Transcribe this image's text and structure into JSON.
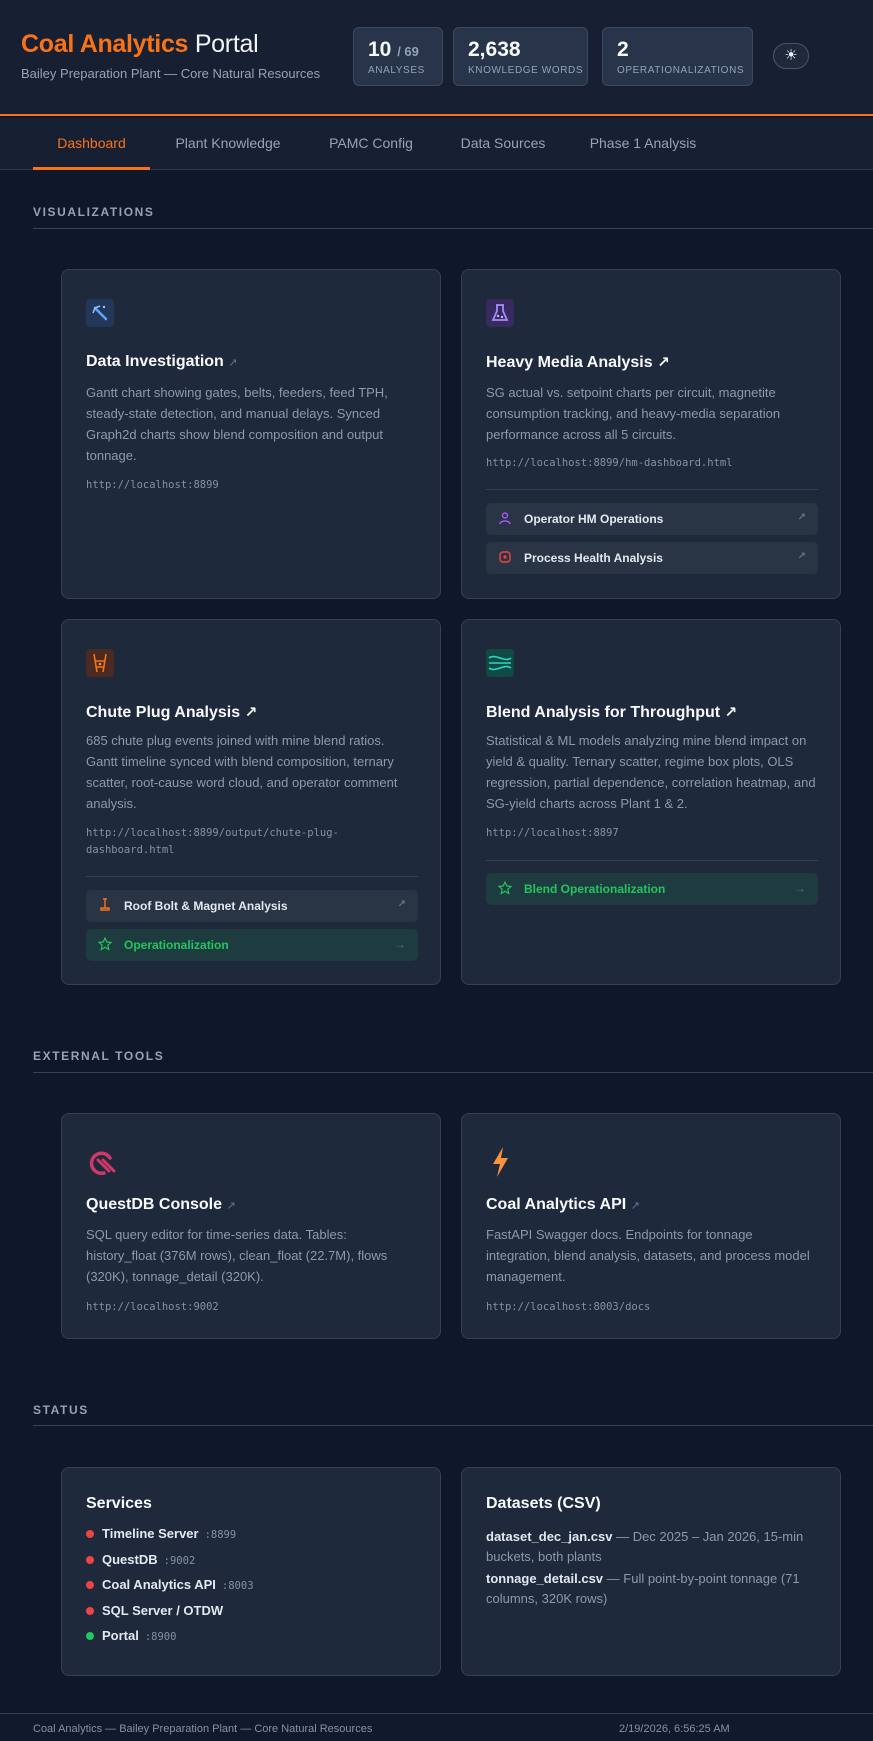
{
  "header": {
    "brand_bold": "Coal Analytics",
    "brand_light": "Portal",
    "subtitle": "Bailey Preparation Plant — Core Natural Resources",
    "stats": [
      {
        "value": "10",
        "value_sub": "/ 69",
        "label": "ANALYSES"
      },
      {
        "value": "2,638",
        "value_sub": "",
        "label": "KNOWLEDGE WORDS"
      },
      {
        "value": "2",
        "value_sub": "",
        "label": "OPERATIONALIZATIONS"
      }
    ],
    "theme_icon": "sun-icon",
    "theme_glyph": "☀"
  },
  "tabs": [
    "Dashboard",
    "Plant Knowledge",
    "PAMC Config",
    "Data Sources",
    "Phase 1 Analysis"
  ],
  "active_tab": "Dashboard",
  "sections": {
    "visualizations": "VISUALIZATIONS",
    "external_tools": "EXTERNAL TOOLS",
    "status": "STATUS"
  },
  "visualizations": [
    {
      "icon": "magic-wand-icon",
      "title": "Data Investigation",
      "arrow": "↗",
      "desc": "Gantt chart showing gates, belts, feeders, feed TPH, steady-state detection, and manual delays. Synced Graph2d charts show blend composition and output tonnage.",
      "url": "http://localhost:8899"
    },
    {
      "icon": "flask-icon",
      "title": "Heavy Media Analysis",
      "arrow": "↗",
      "desc": "SG actual vs. setpoint charts per circuit, magnetite consumption tracking, and heavy-media separation performance across all 5 circuits.",
      "url": "http://localhost:8899/hm-dashboard.html",
      "links": [
        {
          "icon": "person-icon",
          "label": "Operator HM Operations",
          "arrow": "↗"
        },
        {
          "icon": "health-icon",
          "label": "Process Health Analysis",
          "arrow": "↗"
        }
      ]
    },
    {
      "icon": "chute-icon",
      "title": "Chute Plug Analysis",
      "arrow": "↗",
      "desc": "685 chute plug events joined with mine blend ratios. Gantt timeline synced with blend composition, ternary scatter, root-cause word cloud, and operator comment analysis.",
      "url": "http://localhost:8899/output/chute-plug-dashboard.html",
      "links": [
        {
          "icon": "bolt-icon",
          "label": "Roof Bolt & Magnet Analysis",
          "arrow": "↗"
        },
        {
          "icon": "star-icon",
          "label": "Operationalization",
          "arrow": "→"
        }
      ]
    },
    {
      "icon": "blend-waves-icon",
      "title": "Blend Analysis for Throughput",
      "arrow": "↗",
      "desc": "Statistical & ML models analyzing mine blend impact on yield & quality. Ternary scatter, regime box plots, OLS regression, partial dependence, correlation heatmap, and SG-yield charts across Plant 1 & 2.",
      "url": "http://localhost:8897",
      "links": [
        {
          "icon": "star-icon",
          "label": "Blend Operationalization",
          "arrow": "→"
        }
      ]
    }
  ],
  "external_tools": [
    {
      "icon": "questdb-logo-icon",
      "title": "QuestDB Console",
      "arrow": "↗",
      "desc": "SQL query editor for time-series data. Tables: history_float (376M rows), clean_float (22.7M), flows (320K), tonnage_detail (320K).",
      "url": "http://localhost:9002"
    },
    {
      "icon": "lightning-icon",
      "title": "Coal Analytics API",
      "arrow": "↗",
      "desc": "FastAPI Swagger docs. Endpoints for tonnage integration, blend analysis, datasets, and process model management.",
      "url": "http://localhost:8003/docs"
    }
  ],
  "services": {
    "title": "Services",
    "items": [
      {
        "name": "Timeline Server",
        "port": ":8899",
        "status": "down",
        "color": "#ef4444"
      },
      {
        "name": "QuestDB",
        "port": ":9002",
        "status": "down",
        "color": "#ef4444"
      },
      {
        "name": "Coal Analytics API",
        "port": ":8003",
        "status": "down",
        "color": "#ef4444"
      },
      {
        "name": "SQL Server / OTDW",
        "port": "",
        "status": "down",
        "color": "#ef4444"
      },
      {
        "name": "Portal",
        "port": ":8900",
        "status": "up",
        "color": "#22c55e"
      }
    ]
  },
  "datasets": {
    "title": "Datasets (CSV)",
    "items": [
      {
        "name": "dataset_dec_jan.csv",
        "desc": " — Dec 2025 – Jan 2026, 15-min buckets, both plants"
      },
      {
        "name": "tonnage_detail.csv",
        "desc": " — Full point-by-point tonnage (71 columns, 320K rows)"
      }
    ]
  },
  "footer": {
    "left": "Coal Analytics — Bailey Preparation Plant — Core Natural Resources",
    "right": "2/19/2026, 6:56:25 AM"
  },
  "colors": {
    "accent": "#f97316",
    "background": "#0f172a",
    "card": "#1e293b",
    "status_down": "#ef4444",
    "status_up": "#22c55e"
  }
}
